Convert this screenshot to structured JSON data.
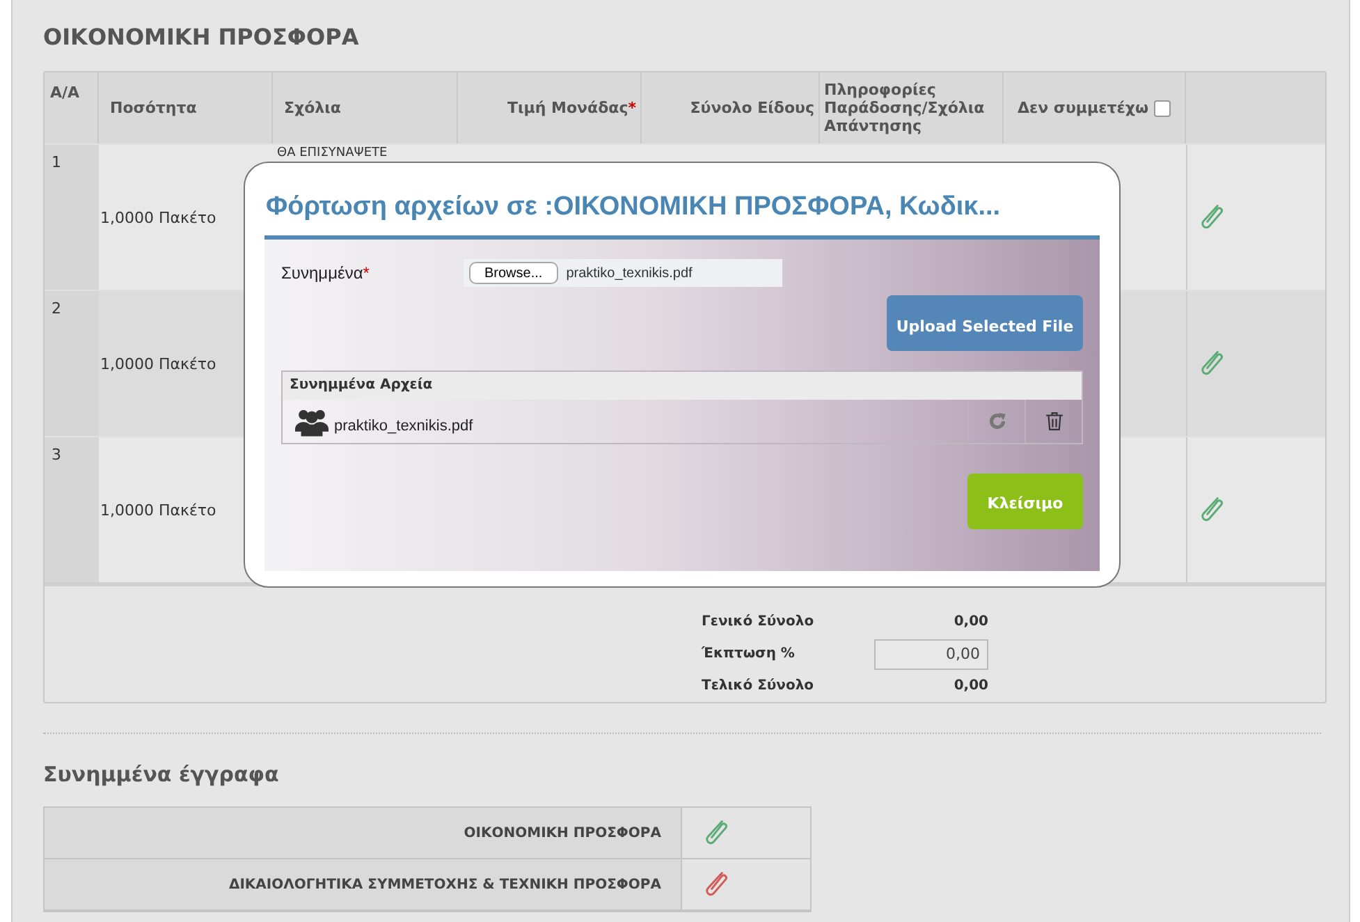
{
  "section_title": "ΟΙΚΟΝΟΜΙΚΗ ΠΡΟΣΦΟΡΑ",
  "table": {
    "columns": [
      {
        "label": "A/A"
      },
      {
        "label": "Ποσότητα"
      },
      {
        "label": "Σχόλια"
      },
      {
        "label": "Τιμή Μονάδας",
        "required_mark": "*"
      },
      {
        "label": "Σύνολο Είδους"
      },
      {
        "label": "Πληροφορίες Παράδοσης/Σχόλια Απάντησης"
      }
    ],
    "opt_out": {
      "label": "Δεν συμμετέχω",
      "checked": false
    },
    "rows": [
      {
        "number": "1",
        "quantity": "1,0000 Πακέτο",
        "comment": "ΘΑ ΕΠΙΣΥΝΑΨΕΤΕ",
        "color": "#5aab74"
      },
      {
        "number": "2",
        "quantity": "1,0000 Πακέτο",
        "color": "#5aab74"
      },
      {
        "number": "3",
        "quantity": "1,0000 Πακέτο",
        "color": "#5aab74"
      }
    ]
  },
  "totals": [
    {
      "label": "Γενικό Σύνολο",
      "kind": "text",
      "value": "0,00"
    },
    {
      "label": "Έκπτωση %",
      "kind": "input",
      "value": "0,00"
    },
    {
      "label": "Τελικό Σύνολο",
      "kind": "text",
      "value": "0,00"
    }
  ],
  "documents": {
    "title": "Συνημμένα έγγραφα",
    "items": [
      {
        "label": "ΟΙΚΟΝΟΜΙΚΗ ΠΡΟΣΦΟΡΑ",
        "color": "#5aab74"
      },
      {
        "label": "ΔΙΚΑΙΟΛΟΓΗΤΙΚΑ ΣΥΜΜΕΤΟΧΗΣ & ΤΕΧΝΙΚΗ ΠΡΟΣΦΟΡΑ",
        "color": "#d45a5a"
      }
    ]
  },
  "modal": {
    "title": "Φόρτωση αρχείων σε :ΟΙΚΟΝΟΜΙΚΗ ΠΡΟΣΦΟΡΑ, Κωδικ...",
    "field_label": "Συνημμένα",
    "required_mark": "*",
    "browse_button": "Browse...",
    "file_name": "praktiko_texnikis.pdf",
    "upload_button": "Upload Selected File",
    "files_header": "Συνημμένα Αρχεία",
    "files": [
      {
        "name": "praktiko_texnikis.pdf"
      }
    ],
    "close_button": "Κλείσιμο"
  }
}
